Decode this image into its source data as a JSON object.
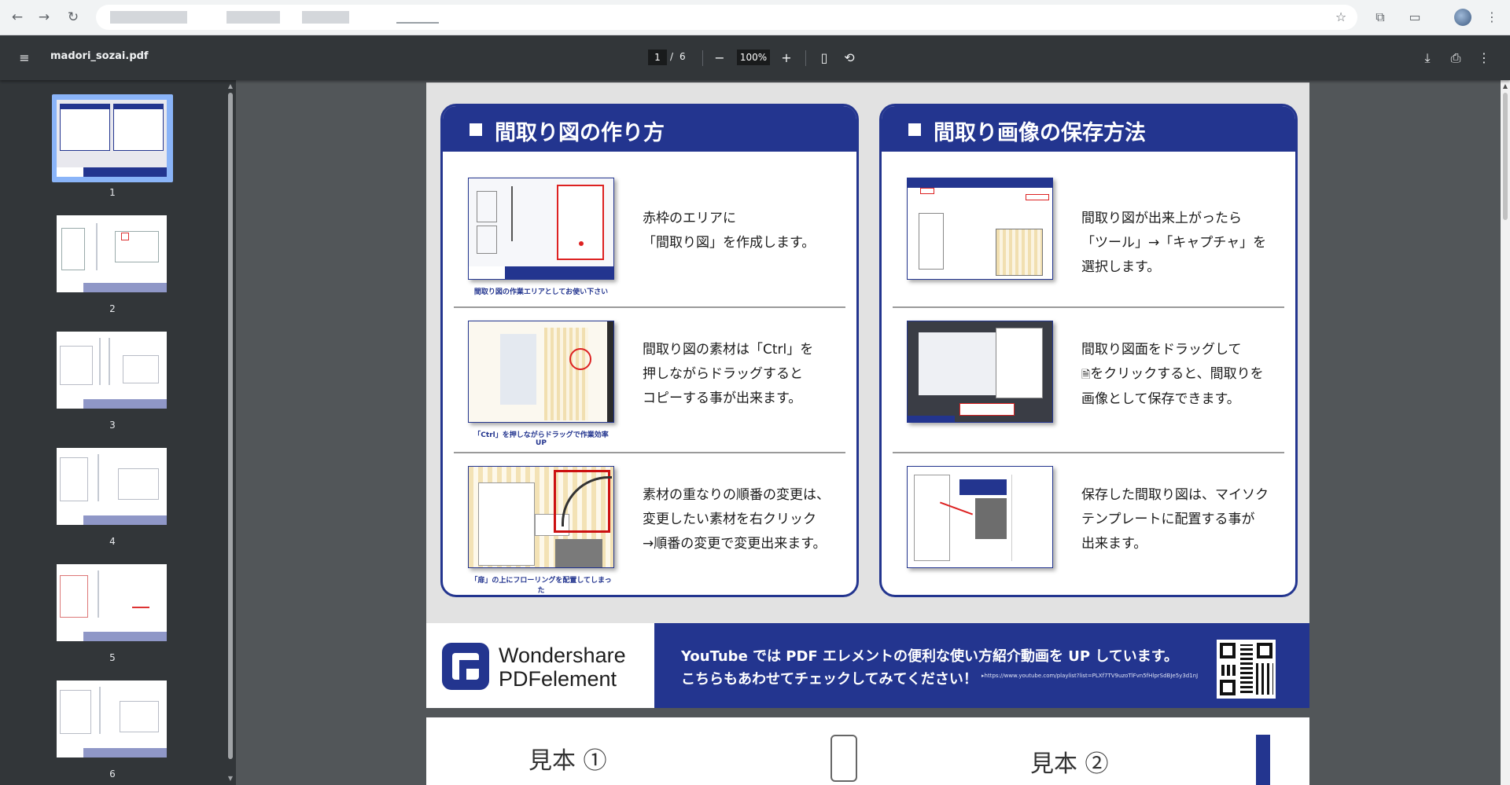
{
  "browser": {
    "back_icon": "arrow-left-icon",
    "forward_icon": "arrow-right-icon",
    "reload_icon": "reload-icon",
    "bookmark_icon": "star-icon",
    "extensions_icon": "puzzle-icon",
    "cast_icon": "cast-icon",
    "menu_icon": "more-vert-icon"
  },
  "toolbar": {
    "menu_glyph": "≡",
    "title": "madori_sozai.pdf",
    "current_page": "1",
    "page_separator": "/",
    "total_pages": "6",
    "zoom_out_glyph": "−",
    "zoom": "100%",
    "zoom_in_glyph": "+",
    "fit_glyph": "▯",
    "rotate_glyph": "⟲",
    "download_glyph": "⤓",
    "print_glyph": "⎙",
    "more_glyph": "⋮"
  },
  "sidebar": {
    "thumbnails": [
      {
        "label": "1"
      },
      {
        "label": "2"
      },
      {
        "label": "3"
      },
      {
        "label": "4"
      },
      {
        "label": "5"
      },
      {
        "label": "6"
      }
    ]
  },
  "page1": {
    "left_panel": {
      "title": "間取り図の作り方",
      "steps": [
        {
          "text_lines": [
            "赤枠のエリアに",
            "「間取り図」を作成します。"
          ],
          "caption": "間取り図の作業エリアとしてお使い下さい"
        },
        {
          "text_lines": [
            "間取り図の素材は「Ctrl」を",
            "押しながらドラッグすると",
            "コピーする事が出来ます。"
          ],
          "caption": "「Ctrl」を押しながらドラッグで作業効率 UP"
        },
        {
          "text_lines": [
            "素材の重なりの順番の変更は、",
            "変更したい素材を右クリック",
            "→順番の変更で変更出来ます。"
          ],
          "caption": "「扉」の上にフローリングを配置してしまった"
        }
      ]
    },
    "right_panel": {
      "title": "間取り画像の保存方法",
      "steps": [
        {
          "text_lines": [
            "間取り図が出来上がったら",
            "「ツール」→「キャプチャ」を",
            "選択します。"
          ]
        },
        {
          "text_lines": [
            "間取り図面をドラッグして",
            "をクリックすると、間取りを",
            "画像として保存できます。"
          ]
        },
        {
          "text_lines": [
            "保存した間取り図は、マイソク",
            "テンプレートに配置する事が",
            "出来ます。"
          ]
        }
      ]
    },
    "footer": {
      "brand_line1": "Wondershare",
      "brand_line2": "PDFelement",
      "line1": "YouTube では PDF エレメントの便利な使い方紹介動画を UP しています。",
      "line2": "こちらもあわせてチェックしてみてください！",
      "url": "▸https://www.youtube.com/playlist?list=PLXf7TV9uzoTlFvn5fHlprSdBJe5y3d1nJ"
    }
  },
  "page2": {
    "sample1": "見本 ①",
    "sample2": "見本 ②"
  },
  "colors": {
    "brand_blue": "#23358f",
    "viewer_bg": "#525659",
    "toolbar_bg": "#323639",
    "selection": "#8ab4f8"
  }
}
